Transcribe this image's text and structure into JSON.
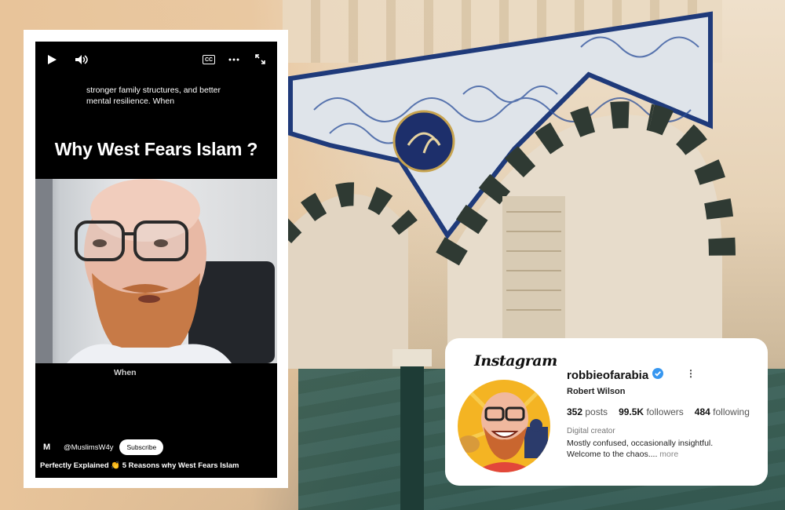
{
  "video": {
    "caption_top": "stronger family structures, and better mental resilience. When",
    "title": "Why West Fears Islam ?",
    "caption_mid": "When",
    "channel_logo": "M",
    "channel_handle": "@MuslimsW4y",
    "subscribe_label": "Subscribe",
    "description": "Perfectly Explained 👏 5 Reasons why West Fears Islam",
    "controls": [
      "play-icon",
      "volume-icon",
      "cc-icon",
      "more-icon",
      "fullscreen-icon"
    ],
    "cc_label": "CC"
  },
  "instagram": {
    "logo_text": "Instagram",
    "username": "robbieofarabia",
    "display_name": "Robert Wilson",
    "posts_count": "352",
    "posts_label": "posts",
    "followers_count": "99.5K",
    "followers_label": "followers",
    "following_count": "484",
    "following_label": "following",
    "category": "Digital creator",
    "bio_line1": "Mostly confused, occasionally insightful.",
    "bio_line2": "Welcome to the chaos....",
    "more_label": "more",
    "verified_color": "#3797f0"
  }
}
